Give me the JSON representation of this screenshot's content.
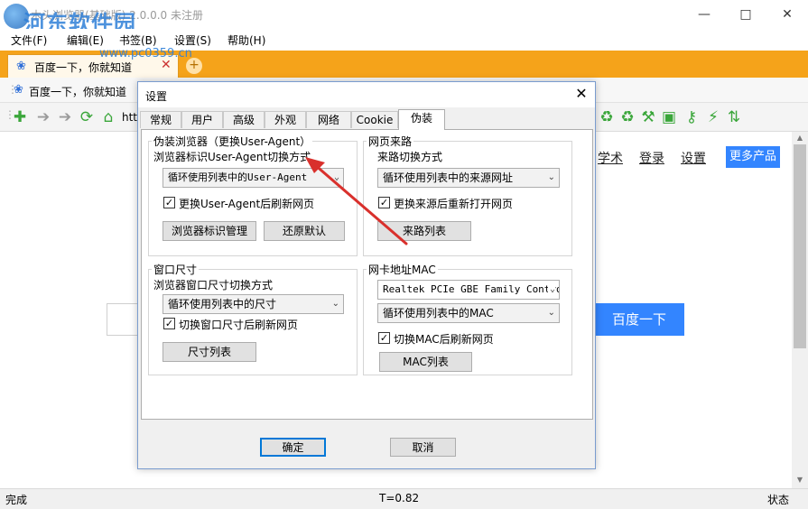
{
  "window": {
    "title": "木头浏览器(基础版) 2.0.0.0 未注册",
    "watermark": "河东软件园",
    "watermark_url": "www.pc0359.cn"
  },
  "menubar": [
    "文件(F)",
    "编辑(E)",
    "书签(B)",
    "设置(S)",
    "帮助(H)"
  ],
  "tab": {
    "label": "百度一下，你就知道",
    "close": "✕",
    "add": "+"
  },
  "favorites": {
    "item": "百度一下，你就知道"
  },
  "address": {
    "prefix": "htt"
  },
  "page": {
    "links": [
      "学术",
      "登录",
      "设置"
    ],
    "more_products": "更多产品",
    "search_button": "百度一下"
  },
  "status": {
    "left": "完成",
    "center": "T=0.82",
    "right": "状态"
  },
  "dialog": {
    "title": "设置",
    "tabs": [
      "常规",
      "用户",
      "高级",
      "外观",
      "网络",
      "Cookie",
      "伪装"
    ],
    "active_tab": "伪装",
    "ua_group": {
      "title": "伪装浏览器（更换User-Agent）",
      "label": "浏览器标识User-Agent切换方式",
      "select": "循环使用列表中的User-Agent",
      "checkbox": "更换User-Agent后刷新网页",
      "btn_manage": "浏览器标识管理",
      "btn_restore": "还原默认"
    },
    "referer_group": {
      "title": "网页来路",
      "label": "来路切换方式",
      "select": "循环使用列表中的来源网址",
      "checkbox": "更换来源后重新打开网页",
      "btn_list": "来路列表"
    },
    "size_group": {
      "title": "窗口尺寸",
      "label": "浏览器窗口尺寸切换方式",
      "select": "循环使用列表中的尺寸",
      "checkbox": "切换窗口尺寸后刷新网页",
      "btn_list": "尺寸列表"
    },
    "mac_group": {
      "title": "网卡地址MAC",
      "adapter": "Realtek PCIe GBE Family Controller",
      "select": "循环使用列表中的MAC",
      "checkbox": "切换MAC后刷新网页",
      "btn_list": "MAC列表"
    },
    "ok": "确定",
    "cancel": "取消"
  },
  "icons": {
    "nav": [
      "add-icon",
      "back-icon",
      "forward-icon",
      "refresh-icon",
      "home-icon"
    ],
    "toolbar_right": [
      "recycle-icon",
      "recycle-alt-icon",
      "tools-icon",
      "crop-icon",
      "key-icon",
      "plug-icon",
      "sort-icon"
    ]
  },
  "colors": {
    "tabbar": "#f5a31a",
    "accent": "#3385ff",
    "annotation_arrow": "#d9302c"
  }
}
